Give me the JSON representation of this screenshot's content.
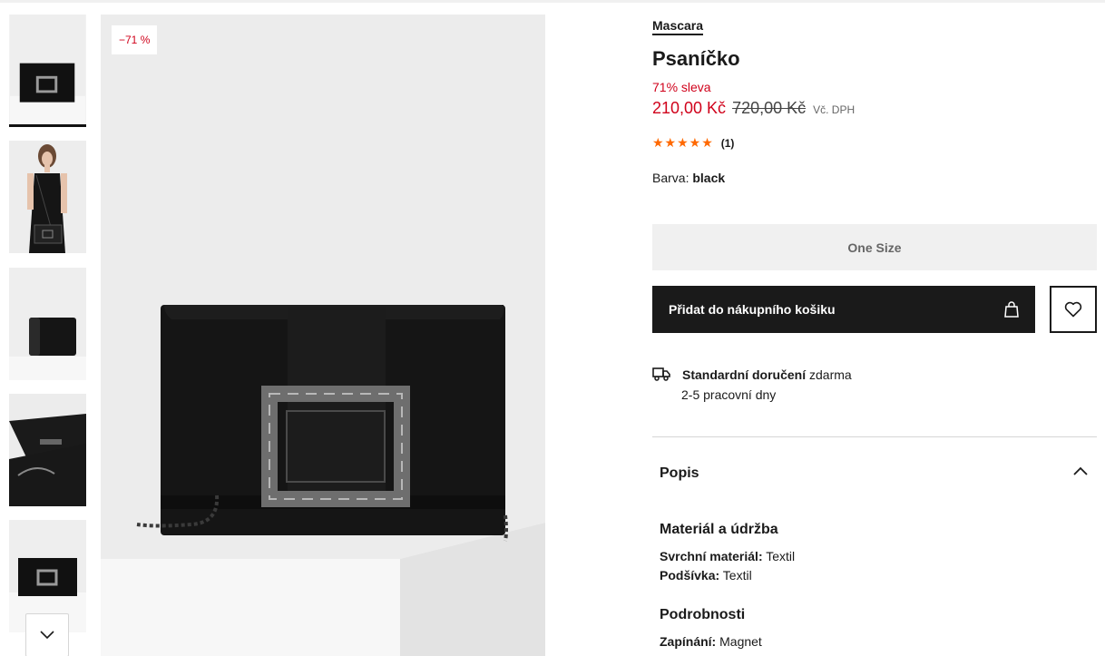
{
  "product": {
    "brand": "Mascara",
    "title": "Psaníčko",
    "discount_badge": "−71 %",
    "sale_label": "71% sleva",
    "price_current": "210,00 Kč",
    "price_original": "720,00 Kč",
    "vat_note": "Vč. DPH",
    "rating_stars": 5,
    "rating_count": "(1)",
    "color_label": "Barva:",
    "color_value": "black"
  },
  "size": {
    "selected": "One Size"
  },
  "actions": {
    "add_to_cart": "Přidat do nákupního košiku",
    "wishlist_icon": "heart-icon",
    "cart_icon": "shopping-bag-icon"
  },
  "delivery": {
    "icon": "truck-icon",
    "title": "Standardní doručení",
    "price": "zdarma",
    "time": "2-5 pracovní dny"
  },
  "description": {
    "heading": "Popis",
    "expanded": true,
    "sections": [
      {
        "title": "Materiál a údržba",
        "attributes": [
          {
            "label": "Svrchní materiál:",
            "value": "Textil"
          },
          {
            "label": "Podšívka:",
            "value": "Textil"
          }
        ]
      },
      {
        "title": "Podrobnosti",
        "attributes": [
          {
            "label": "Zapínání:",
            "value": "Magnet"
          }
        ]
      }
    ]
  },
  "gallery": {
    "thumbnails": [
      "bag-front",
      "model-wearing",
      "bag-side",
      "bag-open-chain",
      "bag-front-small"
    ],
    "active_index": 0
  },
  "colors": {
    "sale": "#d0021b",
    "primary": "#1a1a1a",
    "stars": "#ff6900"
  }
}
